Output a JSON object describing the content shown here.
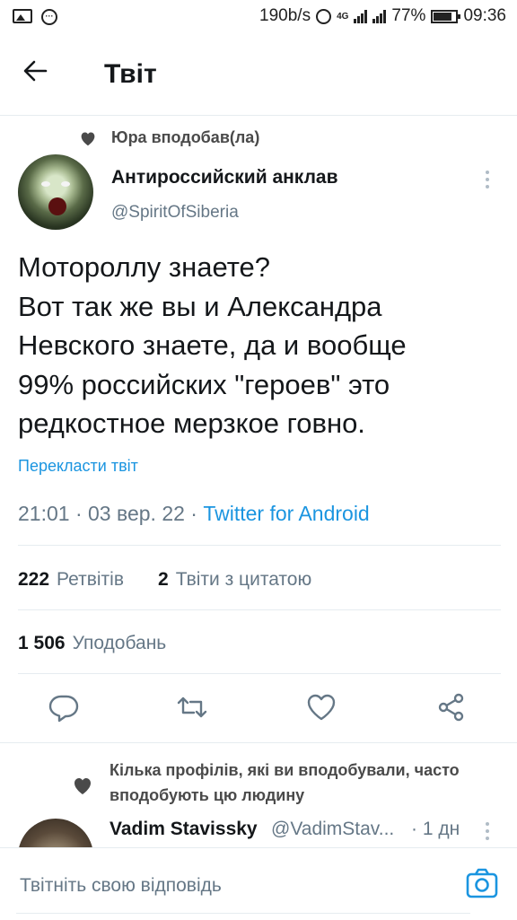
{
  "status_bar": {
    "speed": "190b/s",
    "network": "4G",
    "battery": "77%",
    "time": "09:36"
  },
  "header": {
    "title": "Твіт"
  },
  "liked_by": {
    "text": "Юра вподобав(ла)"
  },
  "tweet": {
    "author_name": "Антироссийский анклав",
    "author_handle": "@SpiritOfSiberia",
    "text_lines": [
      "Мотороллу знаете?",
      "Вот так же вы и Александра",
      "Невского знаете, да и вообще",
      "99% российских \"героев\" это",
      "редкостное мерзкое говно."
    ],
    "translate_label": "Перекласти твіт",
    "time": "21:01",
    "date": "03 вер. 22",
    "client": "Twitter for Android",
    "retweets_count": "222",
    "retweets_label": "Ретвітів",
    "quotes_count": "2",
    "quotes_label": "Твіти з цитатою",
    "likes_count": "1 506",
    "likes_label": "Уподобань"
  },
  "actions": {
    "icons": [
      "reply-icon",
      "retweet-icon",
      "like-icon",
      "share-icon"
    ]
  },
  "suggestion": {
    "text": "Кілька профілів, які ви вподобували, часто вподобують цю людину"
  },
  "next_profile": {
    "name": "Vadim Stavissky",
    "handle": "@VadimStav...",
    "time": "· 1 дн"
  },
  "reply": {
    "placeholder": "Твітніть свою відповідь"
  },
  "colors": {
    "accent": "#1b95e0",
    "secondary_text": "#657786",
    "divider": "#e6ecf0"
  }
}
